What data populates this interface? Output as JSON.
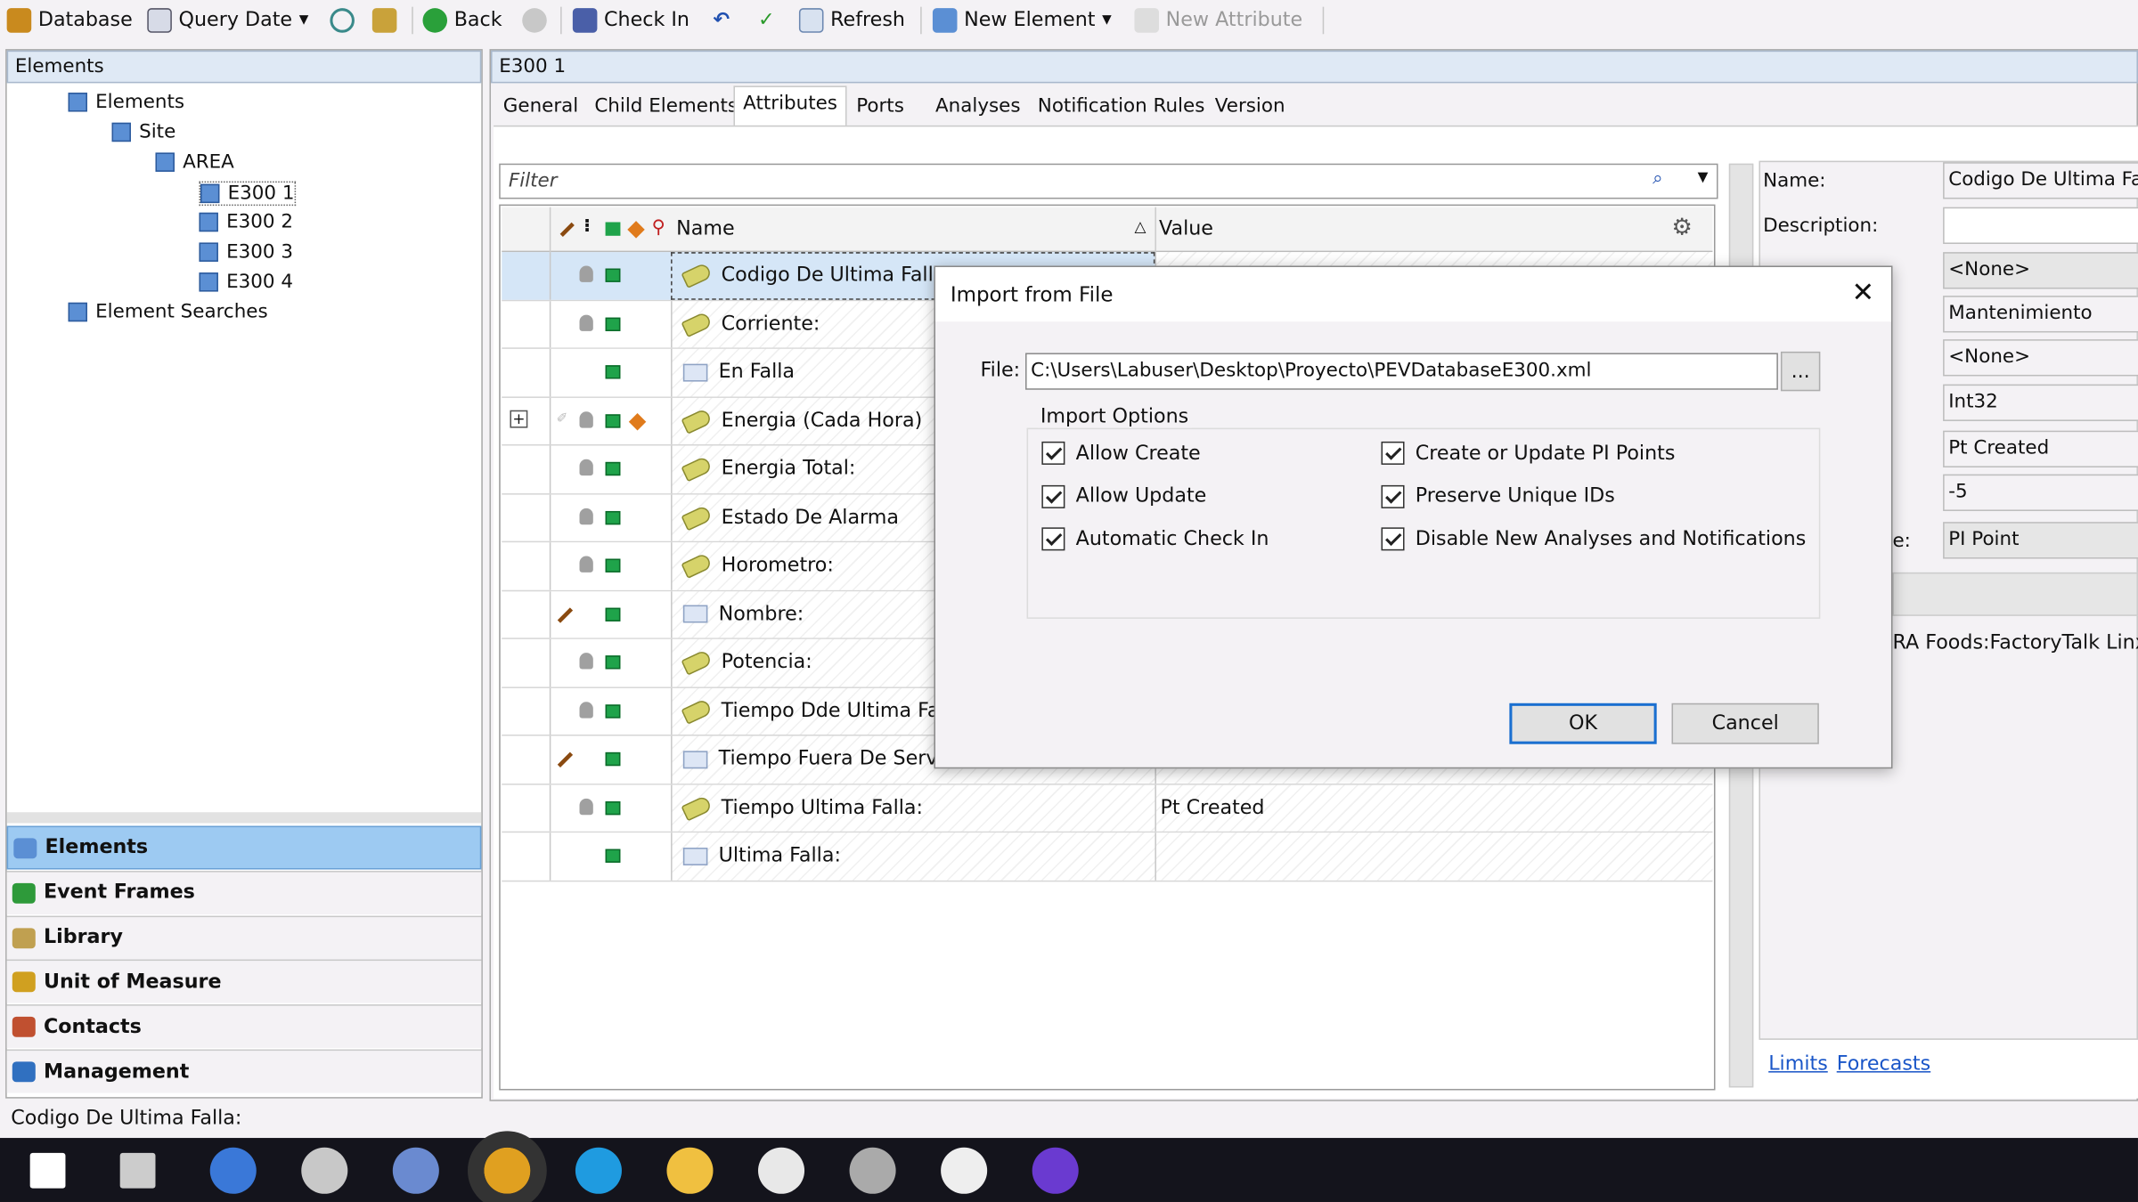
{
  "toolbar": {
    "database": "Database",
    "query_date": "Query Date",
    "back": "Back",
    "check_in": "Check In",
    "refresh": "Refresh",
    "new_element": "New Element",
    "new_attribute": "New Attribute"
  },
  "left": {
    "header": "Elements",
    "tree": [
      {
        "label": "Elements"
      },
      {
        "label": "Site"
      },
      {
        "label": "AREA"
      },
      {
        "label": "E300 1"
      },
      {
        "label": "E300 2"
      },
      {
        "label": "E300 3"
      },
      {
        "label": "E300 4"
      },
      {
        "label": "Element Searches"
      }
    ],
    "nav": [
      {
        "label": "Elements",
        "color": "#5b8fd4"
      },
      {
        "label": "Event Frames",
        "color": "#2e9a3a"
      },
      {
        "label": "Library",
        "color": "#c0a050"
      },
      {
        "label": "Unit of Measure",
        "color": "#d0a020"
      },
      {
        "label": "Contacts",
        "color": "#c05030"
      },
      {
        "label": "Management",
        "color": "#3070c0"
      }
    ]
  },
  "main": {
    "header": "E300 1",
    "tabs": [
      "General",
      "Child Elements",
      "Attributes",
      "Ports",
      "Analyses",
      "Notification Rules",
      "Version"
    ],
    "selected_tab": "Attributes",
    "filter_placeholder": "Filter",
    "col_name": "Name",
    "col_value": "Value",
    "rows": [
      {
        "name": "Codigo De Ultima Falla:",
        "icon": "pi-point-tag",
        "value": "",
        "flags": [
          "lock",
          "good"
        ],
        "selected": true
      },
      {
        "name": "Corriente:",
        "icon": "pi-point-tag",
        "value": "",
        "flags": [
          "lock",
          "good"
        ]
      },
      {
        "name": "En Falla",
        "icon": "table",
        "value": "",
        "flags": [
          "good"
        ]
      },
      {
        "name": "Energia (Cada Hora)",
        "icon": "pi-point-tag",
        "value": "",
        "flags": [
          "lock",
          "good",
          "orange"
        ],
        "expand": true
      },
      {
        "name": "Energia Total:",
        "icon": "pi-point-tag",
        "value": "",
        "flags": [
          "lock",
          "good"
        ]
      },
      {
        "name": "Estado De Alarma",
        "icon": "pi-point-tag",
        "value": "",
        "flags": [
          "lock",
          "good"
        ]
      },
      {
        "name": "Horometro:",
        "icon": "pi-point-tag",
        "value": "",
        "flags": [
          "lock",
          "good"
        ]
      },
      {
        "name": "Nombre:",
        "icon": "table",
        "value": "",
        "flags": [
          "edit",
          "good"
        ]
      },
      {
        "name": "Potencia:",
        "icon": "pi-point-tag",
        "value": "",
        "flags": [
          "lock",
          "good"
        ]
      },
      {
        "name": "Tiempo Dde Ultima Falla:",
        "icon": "pi-point-tag",
        "value": "",
        "flags": [
          "lock",
          "good"
        ]
      },
      {
        "name": "Tiempo Fuera De Servicio:",
        "icon": "table",
        "value": "",
        "flags": [
          "edit",
          "good"
        ]
      },
      {
        "name": "Tiempo Ultima Falla:",
        "icon": "pi-point-tag",
        "value": "Pt Created",
        "flags": [
          "lock",
          "good"
        ]
      },
      {
        "name": "Ultima Falla:",
        "icon": "table",
        "value": "",
        "flags": [
          "good"
        ]
      }
    ]
  },
  "props": {
    "name_label": "Name:",
    "desc_label": "Description:",
    "partial_label": "e:",
    "name": "Codigo De Ultima Falla:",
    "description": "",
    "cat": "<None>",
    "category": "Mantenimiento",
    "uom": "<None>",
    "type": "Int32",
    "default": "Pt Created",
    "value": "-5",
    "data_reference": "PI Point",
    "path": "RA Foods:FactoryTalk Linx:E",
    "limits": "Limits",
    "forecasts": "Forecasts"
  },
  "dialog": {
    "title": "Import from File",
    "file_label": "File:",
    "file": "C:\\Users\\Labuser\\Desktop\\Proyecto\\PEVDatabaseE300.xml",
    "browse": "...",
    "group": "Import Options",
    "options": [
      {
        "label": "Allow Create",
        "checked": true
      },
      {
        "label": "Allow Update",
        "checked": true
      },
      {
        "label": "Automatic Check In",
        "checked": true
      },
      {
        "label": "Create or Update PI Points",
        "checked": true
      },
      {
        "label": "Preserve Unique IDs",
        "checked": true
      },
      {
        "label": "Disable New Analyses and Notifications",
        "checked": true
      }
    ],
    "ok": "OK",
    "cancel": "Cancel"
  },
  "status": "Codigo De Ultima Falla:",
  "taskbar": [
    "start",
    "search",
    "pi-system-explorer",
    "tool",
    "browser-globe",
    "pi-vision",
    "edge",
    "file-explorer",
    "clock",
    "tool2",
    "notepad",
    "studio"
  ]
}
